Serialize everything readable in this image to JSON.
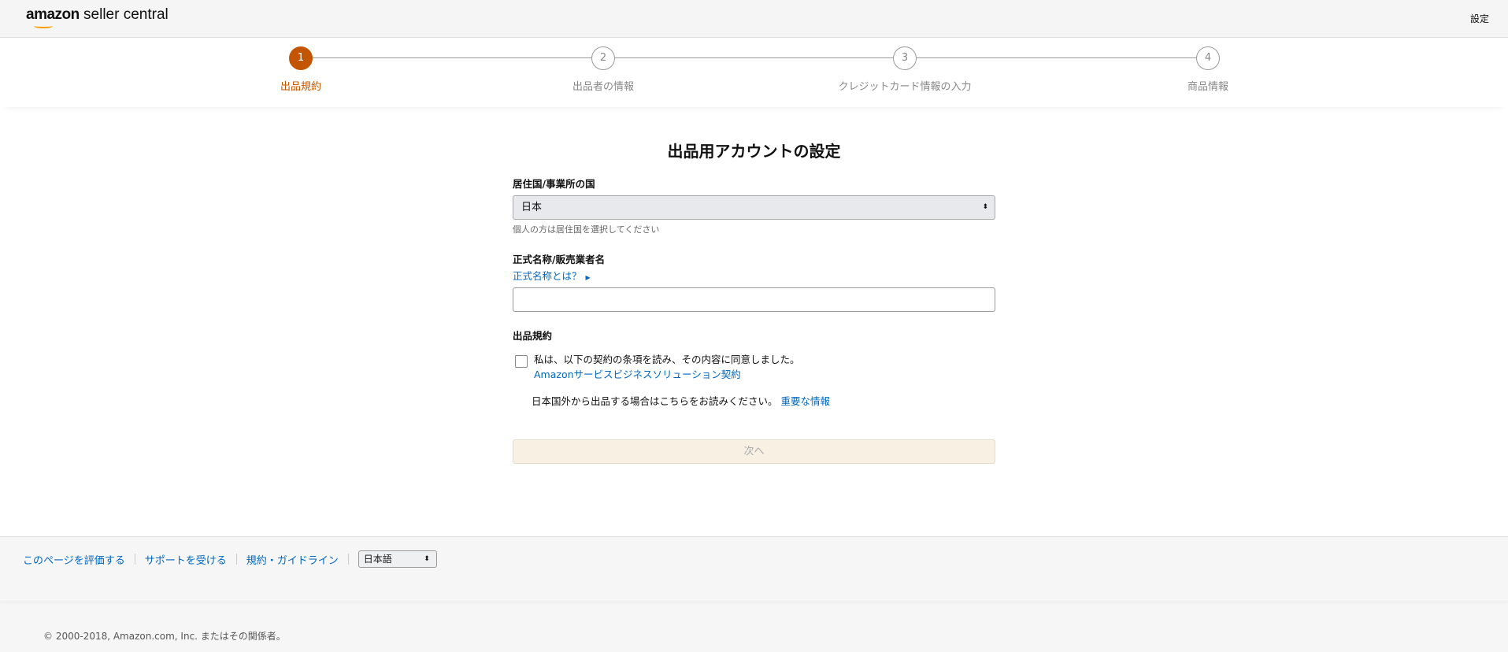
{
  "header": {
    "logo_bold": "amazon",
    "logo_rest": " seller central",
    "settings": "設定"
  },
  "steps": [
    {
      "number": "1",
      "label": "出品規約",
      "active": true
    },
    {
      "number": "2",
      "label": "出品者の情報",
      "active": false
    },
    {
      "number": "3",
      "label": "クレジットカード情報の入力",
      "active": false
    },
    {
      "number": "4",
      "label": "商品情報",
      "active": false
    }
  ],
  "form": {
    "title": "出品用アカウントの設定",
    "country_label": "居住国/事業所の国",
    "country_value": "日本",
    "country_hint": "個人の方は居住国を選択してください",
    "name_label": "正式名称/販売業者名",
    "name_help_link": "正式名称とは？",
    "name_value": "",
    "terms_label": "出品規約",
    "agree_text": "私は、以下の契約の条項を読み、その内容に同意しました。",
    "agree_checked": false,
    "contract_link": "Amazonサービスビジネスソリューション契約",
    "overseas_text": "日本国外から出品する場合はこちらをお読みください。",
    "overseas_link": "重要な情報",
    "next_button": "次へ"
  },
  "footer": {
    "links": [
      "このページを評価する",
      "サポートを受ける",
      "規約・ガイドライン"
    ],
    "language": "日本語",
    "copyright": "© 2000-2018, Amazon.com, Inc. またはその関係者。"
  },
  "colors": {
    "accent": "#c45500",
    "link": "#0066c0"
  }
}
